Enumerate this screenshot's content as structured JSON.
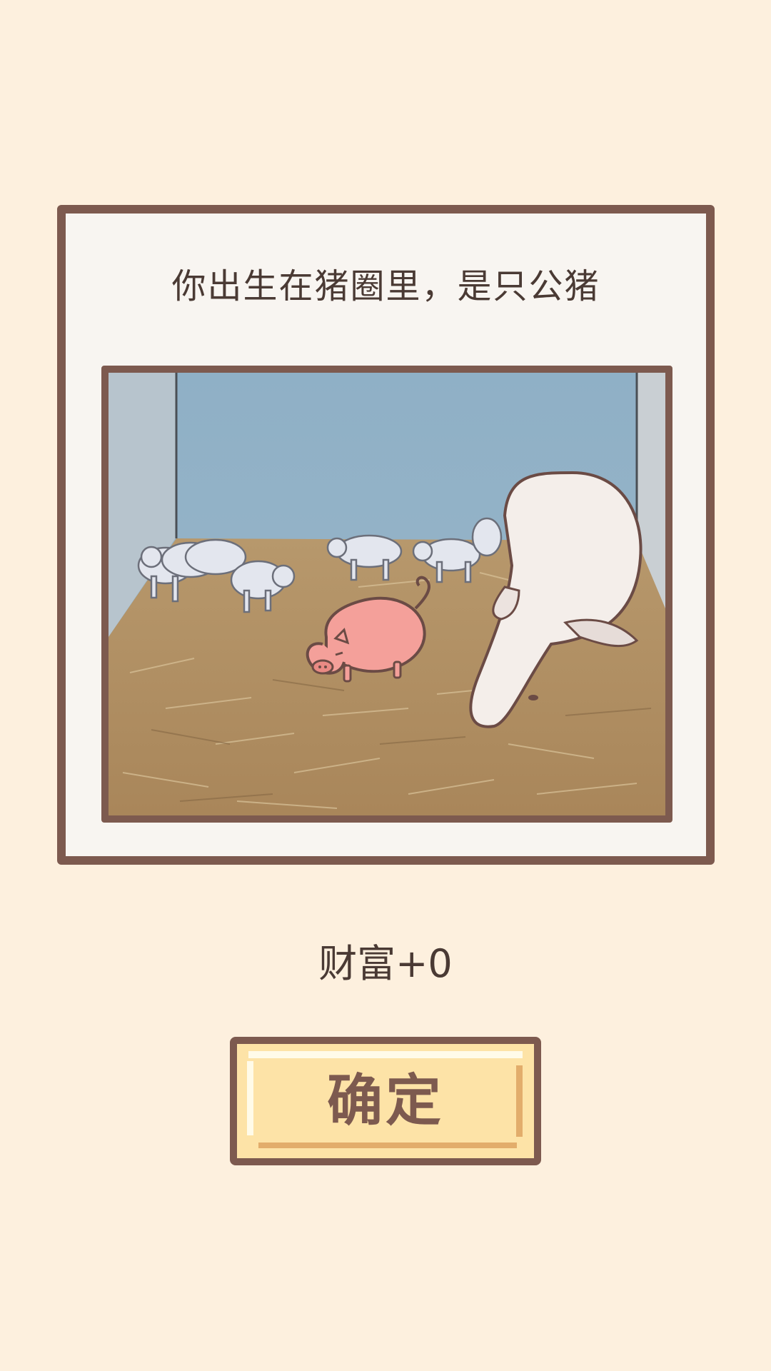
{
  "event": {
    "message": "你出生在猪圈里，是只公猪",
    "wealth": "财富+0"
  },
  "actions": {
    "confirm_label": "确定"
  },
  "colors": {
    "background": "#fdf0de",
    "frame_border": "#7d5a4f",
    "card_fill": "#f8f5f1",
    "button_fill": "#fde3a7",
    "text": "#4a3a34"
  },
  "scene": {
    "image": "pigpen-with-sow-piglets-and-cartoon-pink-piglet"
  }
}
